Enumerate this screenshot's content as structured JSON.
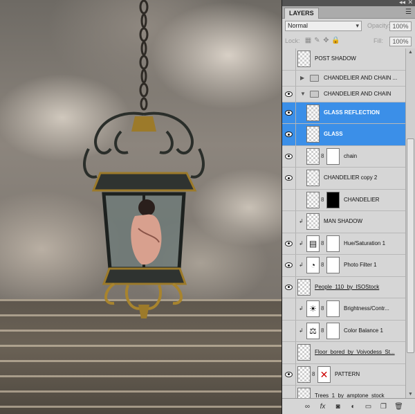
{
  "panel": {
    "tab_label": "LAYERS",
    "panel_menu_icon": "panel-menu-icon",
    "blend_mode": "Normal",
    "opacity_label": "Opacity:",
    "opacity_value": "100%",
    "lock_label": "Lock:",
    "fill_label": "Fill:",
    "fill_value": "100%"
  },
  "layers": [
    {
      "name": "POST SHADOW",
      "visible": false,
      "type": "layer"
    },
    {
      "name": "CHANDELIER AND CHAIN ...",
      "visible": false,
      "type": "group",
      "expanded": false
    },
    {
      "name": "CHANDELIER AND CHAIN",
      "visible": true,
      "type": "group",
      "expanded": true
    },
    {
      "name": "GLASS REFLECTION",
      "visible": true,
      "type": "layer",
      "selected": true
    },
    {
      "name": "GLASS",
      "visible": true,
      "type": "layer",
      "selected": true
    },
    {
      "name": "chain",
      "visible": true,
      "type": "layer-mask"
    },
    {
      "name": "CHANDELIER copy 2",
      "visible": true,
      "type": "layer"
    },
    {
      "name": "CHANDELIER",
      "visible": false,
      "type": "layer-mask"
    },
    {
      "name": "MAN SHADOW",
      "visible": false,
      "type": "layer"
    },
    {
      "name": "Hue/Saturation 1",
      "visible": true,
      "type": "adjustment",
      "icon": "hue-saturation-icon"
    },
    {
      "name": "Photo Filter 1",
      "visible": true,
      "type": "adjustment",
      "icon": "photo-filter-icon"
    },
    {
      "name": "People_110_by_ISOStock",
      "visible": true,
      "type": "layer"
    },
    {
      "name": "Brightness/Contr...",
      "visible": false,
      "type": "adjustment",
      "icon": "brightness-contrast-icon"
    },
    {
      "name": "Color Balance 1",
      "visible": false,
      "type": "adjustment",
      "icon": "color-balance-icon"
    },
    {
      "name": "Floor_bored_by_Voivodess_St...",
      "visible": false,
      "type": "layer"
    },
    {
      "name": "PATTERN",
      "visible": true,
      "type": "layer-mask"
    },
    {
      "name": "Trees_1_by_amptone_stock",
      "visible": false,
      "type": "layer"
    }
  ],
  "footer_icons": [
    "link-layers-icon",
    "fx-icon",
    "add-mask-icon",
    "adjustment-layer-icon",
    "new-group-icon",
    "new-layer-icon",
    "trash-icon"
  ],
  "colors": {
    "selection": "#3b8fe8",
    "panel_bg": "#d6d6d6"
  }
}
